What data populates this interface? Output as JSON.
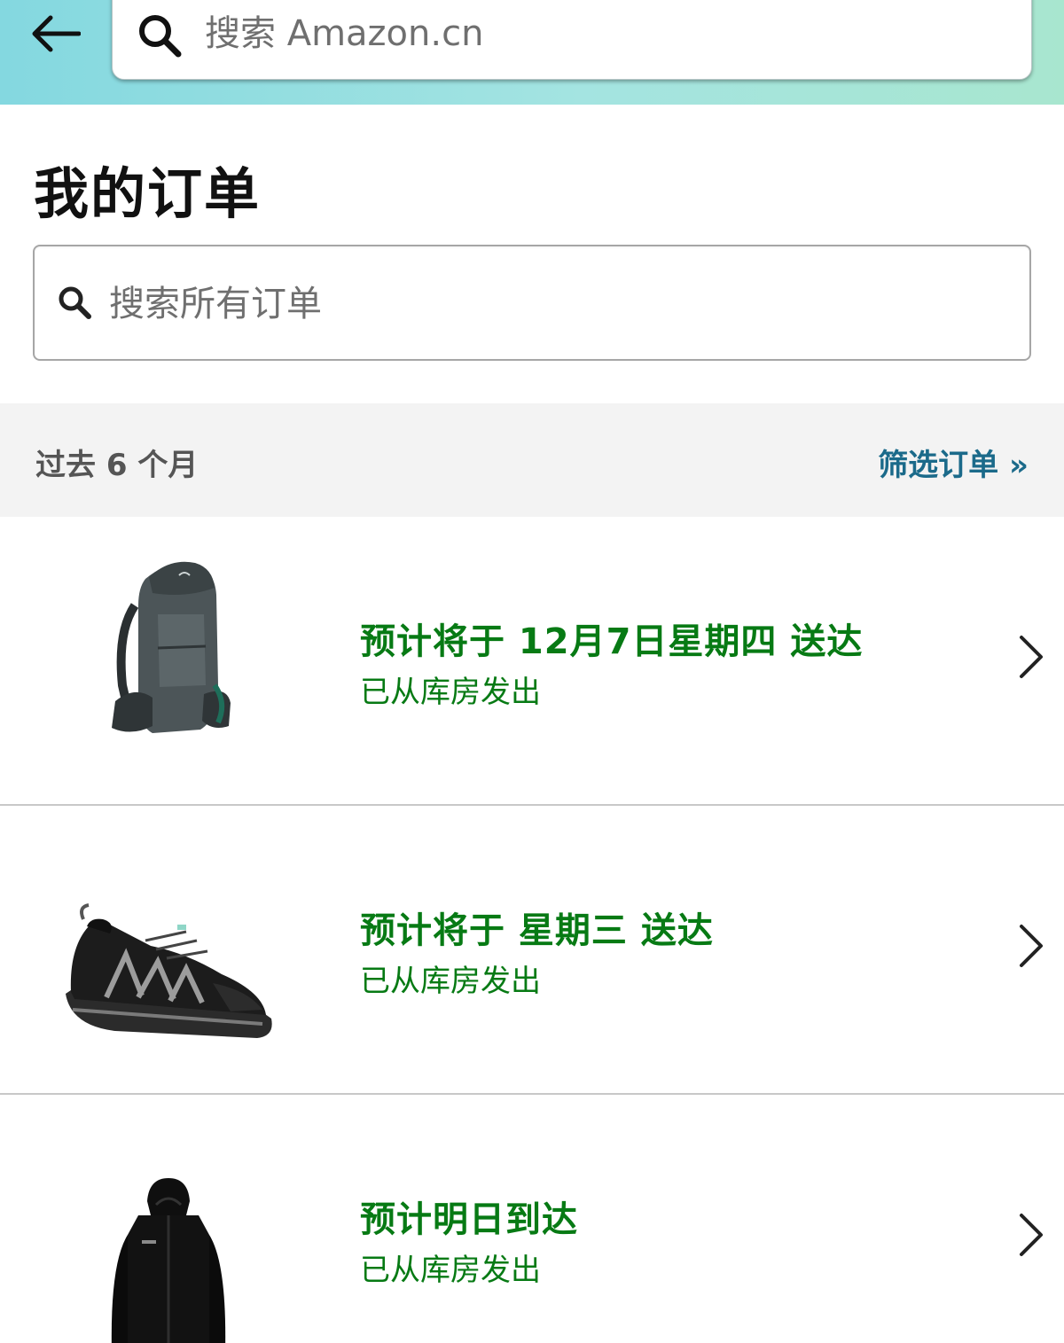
{
  "header": {
    "search_placeholder": "搜索 Amazon.cn"
  },
  "page": {
    "title": "我的订单",
    "order_search_placeholder": "搜索所有订单"
  },
  "filter": {
    "period": "过去 6 个月",
    "link": "筛选订单 »"
  },
  "orders": [
    {
      "item_icon": "backpack-image",
      "status": "预计将于 12月7日星期四 送达",
      "substatus": "已从库房发出"
    },
    {
      "item_icon": "shoe-image",
      "status": "预计将于 星期三 送达",
      "substatus": "已从库房发出"
    },
    {
      "item_icon": "jacket-image",
      "status": "预计明日到达",
      "substatus": "已从库房发出"
    }
  ],
  "colors": {
    "status_green": "#077a14",
    "link_blue": "#1b6a8a",
    "header_gradient_start": "#84d8e0",
    "header_gradient_end": "#a8e6cf"
  }
}
